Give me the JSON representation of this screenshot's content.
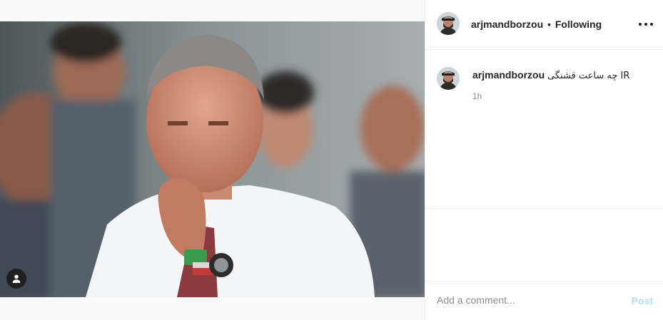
{
  "post": {
    "image_alt": "Man in white shirt with hand on chin"
  },
  "header": {
    "username": "arjmandborzou",
    "separator": "•",
    "follow_label": "Following"
  },
  "comment": {
    "username": "arjmandborzou",
    "caption": "چه ساعت قشنگی IR",
    "time": "1h"
  },
  "comment_box": {
    "placeholder": "Add a comment...",
    "post_label": "Post"
  },
  "colors": {
    "post_disabled": "#b2dffc",
    "muted_text": "#8e8e8e",
    "border": "#efefef"
  }
}
